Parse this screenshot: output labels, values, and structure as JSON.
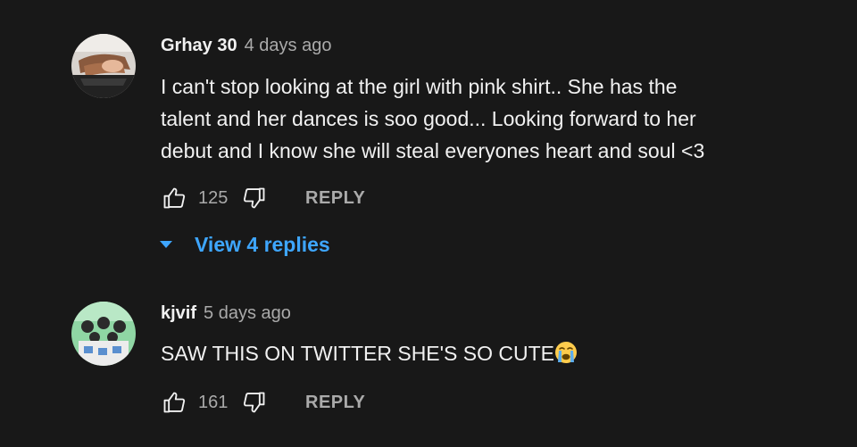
{
  "comments": [
    {
      "author": "Grhay 30",
      "time": "4 days ago",
      "lines": [
        "I can't stop looking at the girl with pink shirt.. She has the",
        "talent and her dances is soo good... Looking forward to her",
        "debut and I know she will steal everyones heart and soul <3"
      ],
      "likes": "125",
      "reply_label": "REPLY",
      "view_replies_label": "View 4 replies"
    },
    {
      "author": "kjvif",
      "time": "5 days ago",
      "text": "SAW THIS ON TWITTER SHE'S SO CUTE",
      "emoji": "loudly-crying-face",
      "likes": "161",
      "reply_label": "REPLY"
    }
  ],
  "colors": {
    "background": "#181818",
    "text": "#f1f1f1",
    "secondary": "#aaaaaa",
    "link": "#3ea6ff"
  }
}
